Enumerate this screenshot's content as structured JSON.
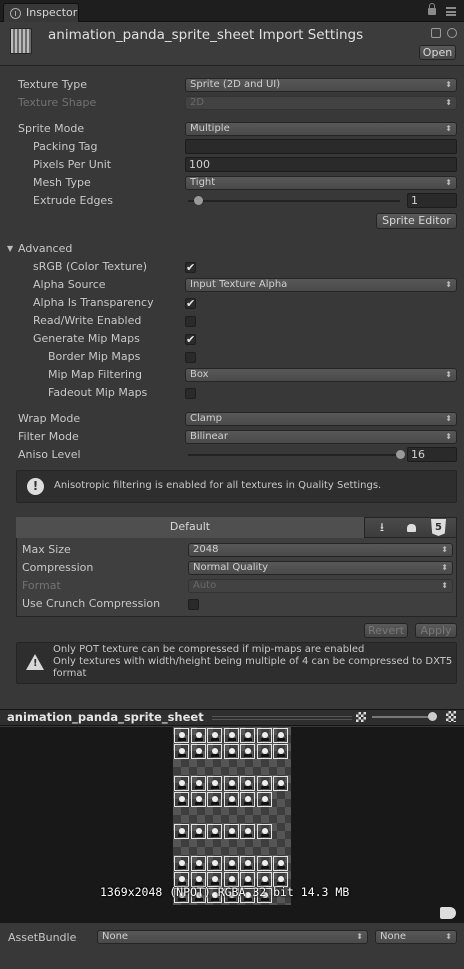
{
  "tab": {
    "label": "Inspector"
  },
  "header": {
    "title": "animation_panda_sprite_sheet Import Settings",
    "open_label": "Open"
  },
  "settings": {
    "texture_type": {
      "label": "Texture Type",
      "value": "Sprite (2D and UI)"
    },
    "texture_shape": {
      "label": "Texture Shape",
      "value": "2D"
    },
    "sprite_mode": {
      "label": "Sprite Mode",
      "value": "Multiple"
    },
    "packing_tag": {
      "label": "Packing Tag",
      "value": ""
    },
    "pixels_per_unit": {
      "label": "Pixels Per Unit",
      "value": "100"
    },
    "mesh_type": {
      "label": "Mesh Type",
      "value": "Tight"
    },
    "extrude_edges": {
      "label": "Extrude Edges",
      "value": "1",
      "fraction": 0.03
    },
    "sprite_editor_label": "Sprite Editor"
  },
  "advanced": {
    "label": "Advanced",
    "srgb": {
      "label": "sRGB (Color Texture)",
      "checked": true
    },
    "alpha_source": {
      "label": "Alpha Source",
      "value": "Input Texture Alpha"
    },
    "alpha_transparency": {
      "label": "Alpha Is Transparency",
      "checked": true
    },
    "read_write": {
      "label": "Read/Write Enabled",
      "checked": false
    },
    "generate_mip": {
      "label": "Generate Mip Maps",
      "checked": true
    },
    "border_mip": {
      "label": "Border Mip Maps",
      "checked": false
    },
    "mip_filtering": {
      "label": "Mip Map Filtering",
      "value": "Box"
    },
    "fadeout_mip": {
      "label": "Fadeout Mip Maps",
      "checked": false
    }
  },
  "wrap": {
    "wrap_mode": {
      "label": "Wrap Mode",
      "value": "Clamp"
    },
    "filter_mode": {
      "label": "Filter Mode",
      "value": "Bilinear"
    },
    "aniso": {
      "label": "Aniso Level",
      "value": "16",
      "fraction": 1.0
    },
    "aniso_info": "Anisotropic filtering is enabled for all textures in Quality Settings."
  },
  "platform": {
    "default_tab": "Default",
    "max_size": {
      "label": "Max Size",
      "value": "2048"
    },
    "compression": {
      "label": "Compression",
      "value": "Normal Quality"
    },
    "format": {
      "label": "Format",
      "value": "Auto"
    },
    "crunch": {
      "label": "Use Crunch Compression",
      "checked": false
    },
    "icons": [
      "download-icon",
      "android-icon",
      "html5-icon"
    ]
  },
  "actions": {
    "revert": "Revert",
    "apply": "Apply"
  },
  "warning": {
    "line1": "Only POT texture can be compressed if mip-maps are enabled",
    "line2": "Only textures with width/height being multiple of 4 can be compressed to DXT5",
    "line3": "format"
  },
  "preview": {
    "title": "animation_panda_sprite_sheet",
    "info": "1369x2048 (NPOT)  RGBA 32 bit   14.3 MB"
  },
  "asset_bundle": {
    "label": "AssetBundle",
    "name": "None",
    "variant": "None"
  },
  "colors": {
    "background": "#383838",
    "tab_bar": "#1e1e1e",
    "preview_bg": "#181818",
    "text": "#c8c8c8"
  }
}
